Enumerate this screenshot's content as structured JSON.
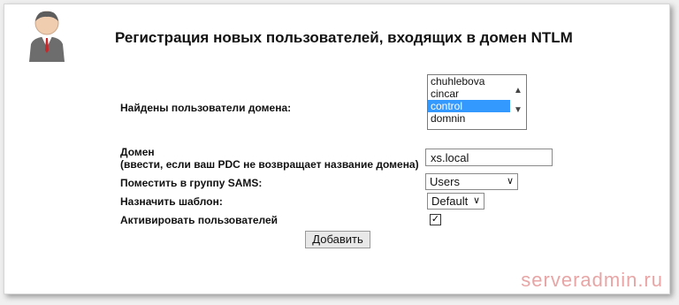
{
  "title": "Регистрация новых пользователей, входящих в домен NTLM",
  "users_label": "Найдены пользователи домена:",
  "users_list": [
    "chuhlebova",
    "cincar",
    "control",
    "domnin"
  ],
  "users_selected": "control",
  "domain_label_1": "Домен",
  "domain_label_2": "(ввести, если ваш PDC не возвращает название домена)",
  "domain_value": "xs.local",
  "group_label": "Поместить в группу SAMS:",
  "group_value": "Users",
  "template_label": "Назначить шаблон:",
  "template_value": "Default",
  "activate_label": "Активировать пользователей",
  "activate_checked": true,
  "add_button": "Добавить",
  "watermark": "serveradmin.ru",
  "icons": {
    "avatar": "user-avatar-icon",
    "checkmark": "checkmark-icon",
    "scroll_up": "chevron-up-icon",
    "scroll_down": "chevron-down-icon",
    "dropdown": "chevron-down-icon"
  },
  "colors": {
    "selection": "#3399ff",
    "watermark": "#e8a5a5"
  }
}
